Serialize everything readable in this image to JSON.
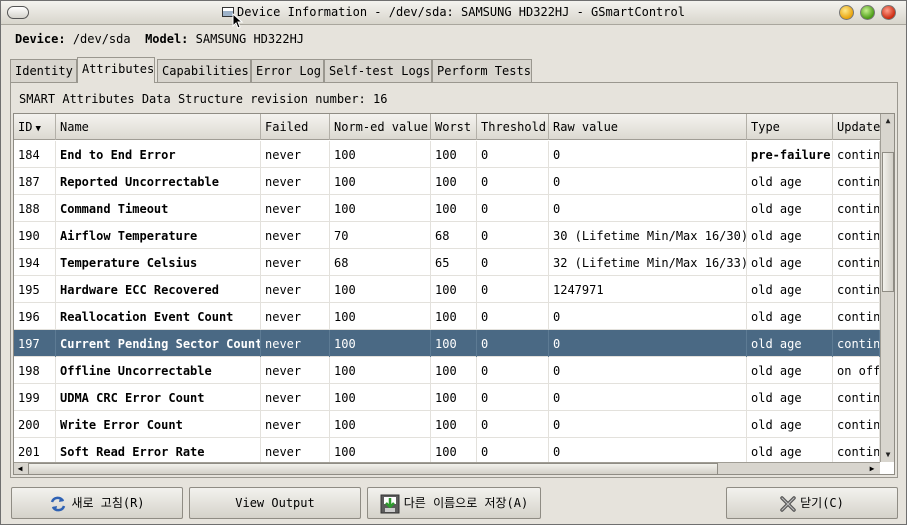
{
  "window": {
    "title": "Device Information - /dev/sda: SAMSUNG HD322HJ - GSmartControl"
  },
  "device": {
    "device_label": "Device:",
    "device_value": "/dev/sda",
    "model_label": "Model:",
    "model_value": "SAMSUNG HD322HJ"
  },
  "tabs": [
    {
      "label": "Identity",
      "active": false
    },
    {
      "label": "Attributes",
      "active": true
    },
    {
      "label": "Capabilities",
      "active": false
    },
    {
      "label": "Error Log",
      "active": false
    },
    {
      "label": "Self-test Logs",
      "active": false
    },
    {
      "label": "Perform Tests",
      "active": false
    }
  ],
  "attributes": {
    "revision_text": "SMART Attributes Data Structure revision number: 16",
    "columns": [
      "ID",
      "Name",
      "Failed",
      "Norm-ed value",
      "Worst",
      "Threshold",
      "Raw value",
      "Type",
      "Update"
    ],
    "rows": [
      {
        "id": "184",
        "name": "End to End Error",
        "failed": "never",
        "norm": "100",
        "worst": "100",
        "threshold": "0",
        "raw": "0",
        "type": "pre-failure",
        "update": "contin",
        "type_bold": true
      },
      {
        "id": "187",
        "name": "Reported Uncorrectable",
        "failed": "never",
        "norm": "100",
        "worst": "100",
        "threshold": "0",
        "raw": "0",
        "type": "old age",
        "update": "contin"
      },
      {
        "id": "188",
        "name": "Command Timeout",
        "failed": "never",
        "norm": "100",
        "worst": "100",
        "threshold": "0",
        "raw": "0",
        "type": "old age",
        "update": "contin"
      },
      {
        "id": "190",
        "name": "Airflow Temperature",
        "failed": "never",
        "norm": "70",
        "worst": "68",
        "threshold": "0",
        "raw": "30 (Lifetime Min/Max 16/30)",
        "type": "old age",
        "update": "contin"
      },
      {
        "id": "194",
        "name": "Temperature Celsius",
        "failed": "never",
        "norm": "68",
        "worst": "65",
        "threshold": "0",
        "raw": "32 (Lifetime Min/Max 16/33)",
        "type": "old age",
        "update": "contin"
      },
      {
        "id": "195",
        "name": "Hardware ECC Recovered",
        "failed": "never",
        "norm": "100",
        "worst": "100",
        "threshold": "0",
        "raw": "1247971",
        "type": "old age",
        "update": "contin"
      },
      {
        "id": "196",
        "name": "Reallocation Event Count",
        "failed": "never",
        "norm": "100",
        "worst": "100",
        "threshold": "0",
        "raw": "0",
        "type": "old age",
        "update": "contin"
      },
      {
        "id": "197",
        "name": "Current Pending Sector Count",
        "failed": "never",
        "norm": "100",
        "worst": "100",
        "threshold": "0",
        "raw": "0",
        "type": "old age",
        "update": "contin",
        "selected": true
      },
      {
        "id": "198",
        "name": "Offline Uncorrectable",
        "failed": "never",
        "norm": "100",
        "worst": "100",
        "threshold": "0",
        "raw": "0",
        "type": "old age",
        "update": "on off"
      },
      {
        "id": "199",
        "name": "UDMA CRC Error Count",
        "failed": "never",
        "norm": "100",
        "worst": "100",
        "threshold": "0",
        "raw": "0",
        "type": "old age",
        "update": "contin"
      },
      {
        "id": "200",
        "name": "Write Error Count",
        "failed": "never",
        "norm": "100",
        "worst": "100",
        "threshold": "0",
        "raw": "0",
        "type": "old age",
        "update": "contin"
      },
      {
        "id": "201",
        "name": "Soft Read Error Rate",
        "failed": "never",
        "norm": "100",
        "worst": "100",
        "threshold": "0",
        "raw": "0",
        "type": "old age",
        "update": "contin"
      }
    ]
  },
  "buttons": {
    "refresh": "새로 고침(R)",
    "view_output": "View Output",
    "save_as": "다른 이름으로 저장(A)",
    "close": "닫기(C)"
  },
  "icons": {
    "refresh": "refresh-icon",
    "save": "save-icon",
    "close": "close-x-icon"
  },
  "colors": {
    "selection": "#4a6984",
    "window_bg": "#e6e3dc"
  }
}
